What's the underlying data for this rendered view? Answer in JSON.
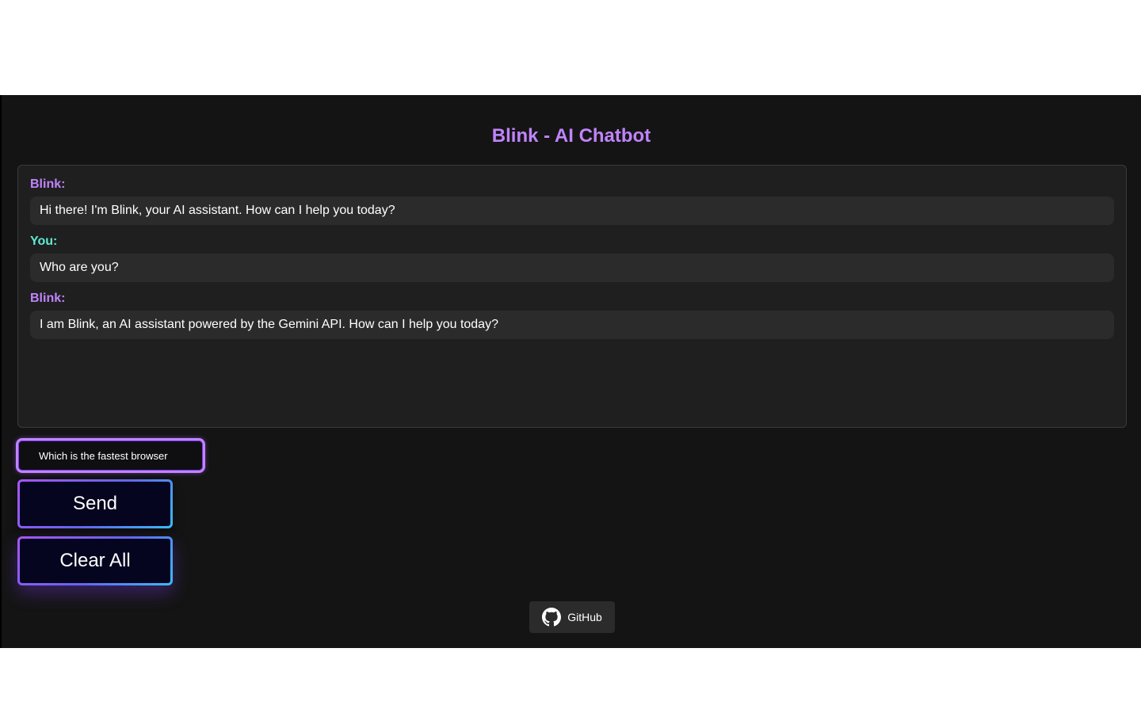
{
  "app": {
    "title": "Blink - AI Chatbot"
  },
  "messages": [
    {
      "sender": "Blink:",
      "role": "bot",
      "text": "Hi there! I'm Blink, your AI assistant. How can I help you today?"
    },
    {
      "sender": "You:",
      "role": "user",
      "text": "Who are you?"
    },
    {
      "sender": "Blink:",
      "role": "bot",
      "text": "I am Blink, an AI assistant powered by the Gemini API. How can I help you today?"
    }
  ],
  "input": {
    "value": "Which is the fastest browser"
  },
  "buttons": {
    "send": "Send",
    "clear": "Clear All"
  },
  "footer": {
    "github_label": "GitHub",
    "github_icon": "github-icon"
  },
  "colors": {
    "accent": "#c084fc",
    "user": "#5eead4",
    "background": "#141414",
    "panel": "#1f1f1f"
  }
}
